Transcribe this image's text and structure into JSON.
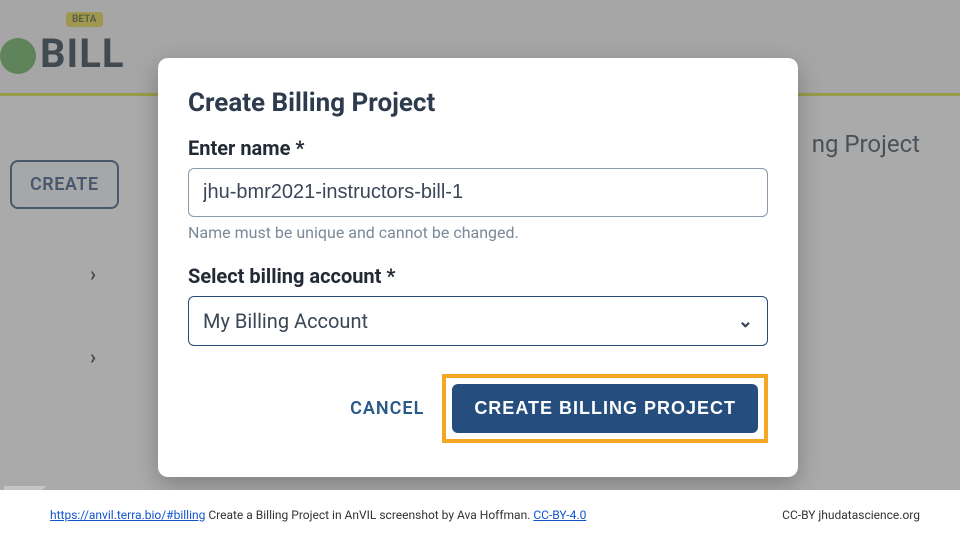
{
  "background": {
    "beta_label": "BETA",
    "title_fragment": "BILL",
    "right_fragment": "ng Project",
    "create_button": "CREATE"
  },
  "modal": {
    "title": "Create Billing Project",
    "name_label": "Enter name *",
    "name_value": "jhu-bmr2021-instructors-bill-1",
    "name_helper": "Name must be unique and cannot be changed.",
    "account_label": "Select billing account *",
    "account_value": "My Billing Account",
    "cancel": "CANCEL",
    "submit": "CREATE BILLING PROJECT"
  },
  "footer": {
    "url_text": "https://anvil.terra.bio/#billing",
    "caption": " Create a Billing Project in AnVIL screenshot by Ava Hoffman. ",
    "license_link": "CC-BY-4.0",
    "attribution": "CC-BY  jhudatascience.org"
  }
}
